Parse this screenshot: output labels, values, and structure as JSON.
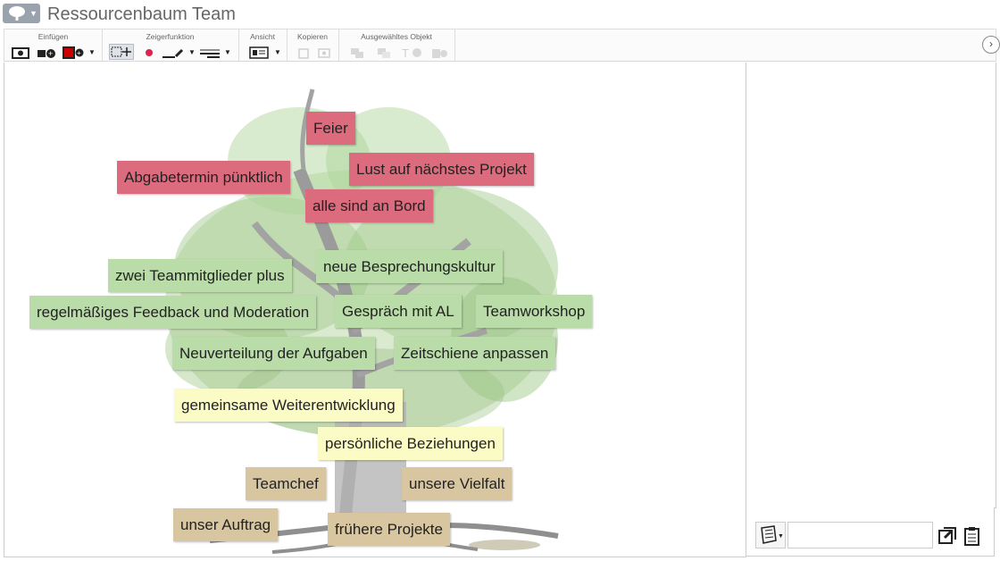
{
  "window": {
    "title": "Ressourcenbaum Team"
  },
  "ribbon": {
    "groups": {
      "einfuegen": "Einfügen",
      "zeiger": "Zeigerfunktion",
      "ansicht": "Ansicht",
      "kopieren": "Kopieren",
      "ausgewaehlt": "Ausgewähltes Objekt"
    }
  },
  "cards": {
    "feier": "Feier",
    "abgabetermin": "Abgabetermin pünktlich",
    "lust": "Lust auf nächstes Projekt",
    "bord": "alle sind an Bord",
    "zwei": "zwei Teammitglieder plus",
    "besprechung": "neue Besprechungskultur",
    "feedback": "regelmäßiges Feedback und Moderation",
    "gespraech": "Gespräch mit AL",
    "workshop": "Teamworkshop",
    "neuverteilung": "Neuverteilung der Aufgaben",
    "zeitschiene": "Zeitschiene anpassen",
    "weiterentwicklung": "gemeinsame Weiterentwicklung",
    "beziehungen": "persönliche Beziehungen",
    "teamchef": "Teamchef",
    "vielfalt": "unsere Vielfalt",
    "auftrag": "unser Auftrag",
    "projekte": "frühere Projekte"
  },
  "colors": {
    "red": "#dc6b7d",
    "green": "#b9dca8",
    "yellow": "#fbfbc6",
    "tan": "#d8c6a1"
  },
  "comment_input": {
    "value": ""
  }
}
